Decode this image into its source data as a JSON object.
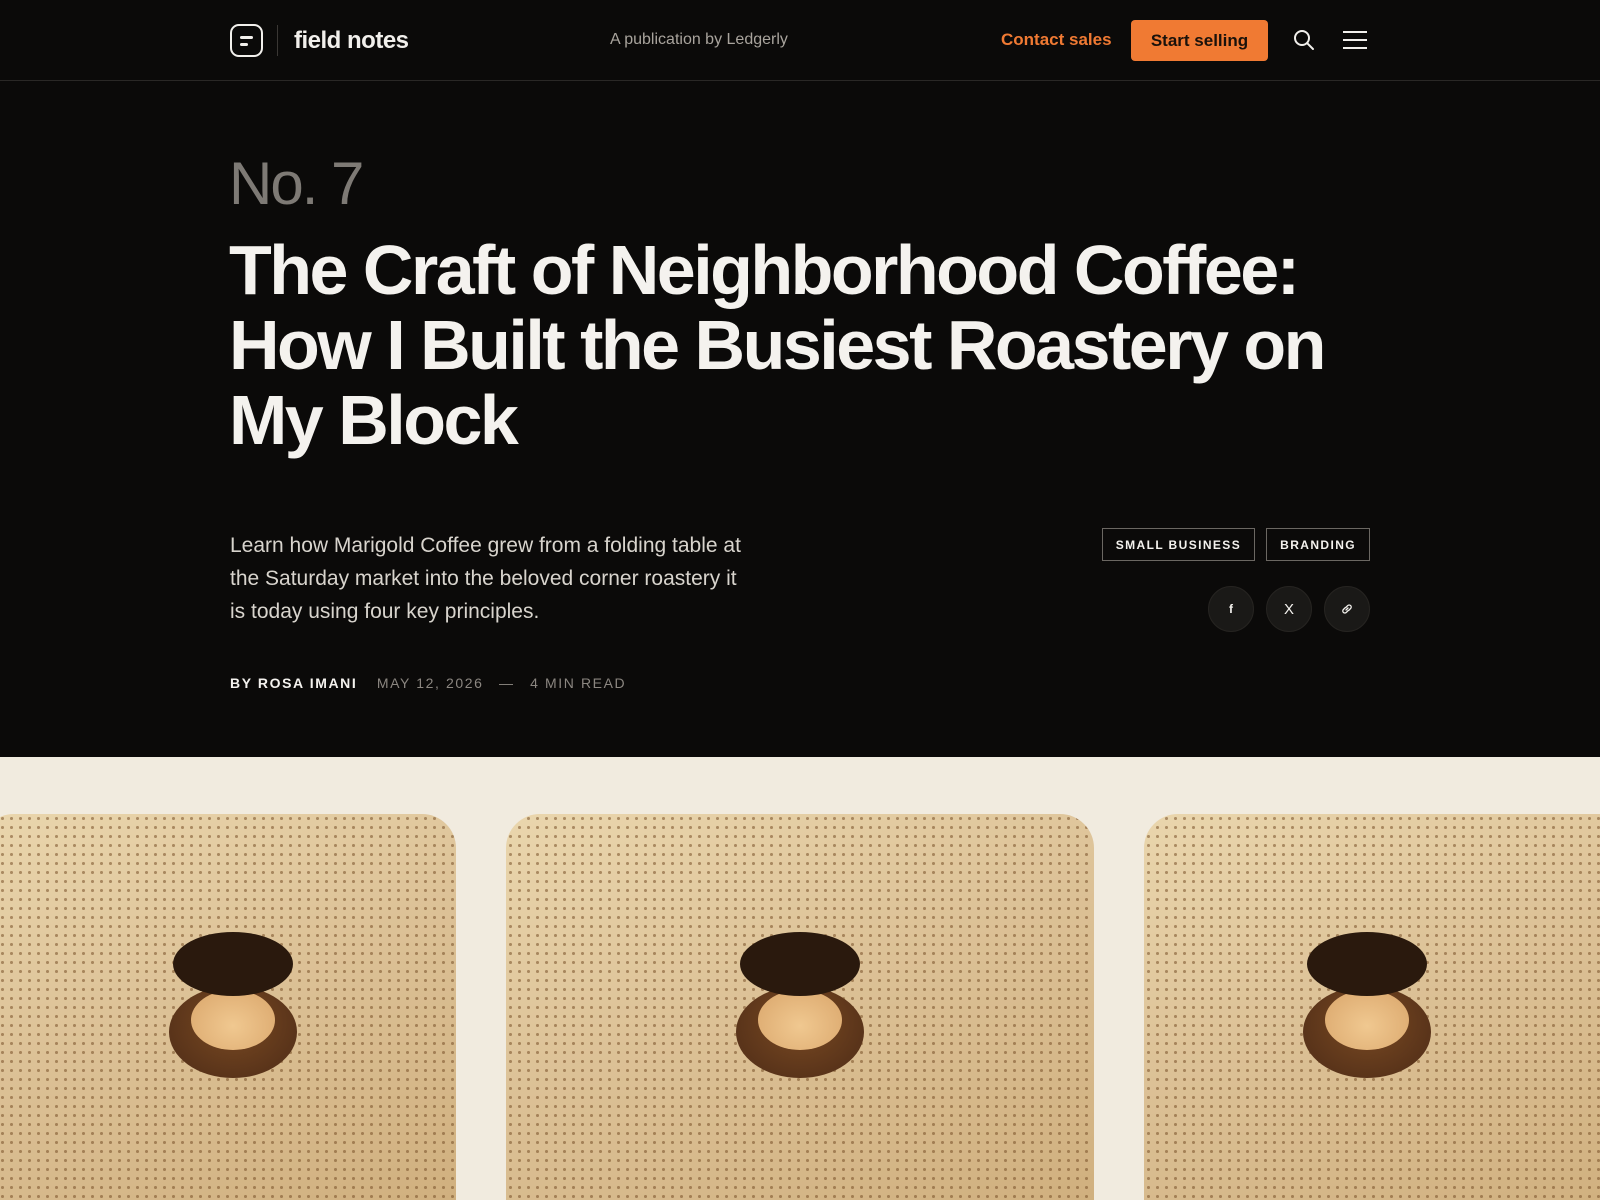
{
  "header": {
    "brand": "field notes",
    "publication": "A publication by Ledgerly",
    "contact_label": "Contact sales",
    "cta_label": "Start selling",
    "icons": [
      "logo-icon",
      "search-icon",
      "menu-icon"
    ],
    "accent_color": "#f07a33"
  },
  "hero": {
    "issue": "No. 7",
    "title": "The Craft of Neighborhood Coffee: How I Built the Busiest Roastery on My Block",
    "lede": "Learn how Marigold Coffee grew from a folding table at the Saturday market into the beloved corner roastery it is today using four key principles.",
    "author": "BY ROSA IMANI",
    "date": "MAY 12, 2026",
    "separator": "—",
    "read_time": "4 MIN READ",
    "tags": [
      "SMALL BUSINESS",
      "BRANDING"
    ],
    "share": [
      {
        "name": "facebook-icon",
        "glyph": "f"
      },
      {
        "name": "x-icon",
        "glyph": "X"
      },
      {
        "name": "link-icon",
        "glyph": ""
      }
    ]
  },
  "gallery": {
    "cards": [
      {
        "name": "coffee-cup-image"
      },
      {
        "name": "coffee-cup-image"
      },
      {
        "name": "coffee-cup-image"
      }
    ],
    "background": "#f1ebdf"
  }
}
